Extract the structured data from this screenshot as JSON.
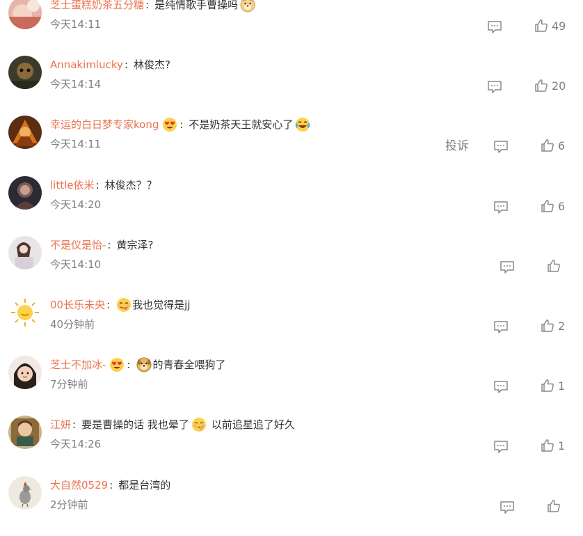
{
  "comments": [
    {
      "user": "芝士蛋糕奶茶五分糖",
      "badge": "",
      "sep": ":",
      "pre_emoji": "",
      "text": "是纯情歌手曹操吗",
      "text_emoji": "doge-icon",
      "text2": "",
      "time": "今天14:11",
      "report": "",
      "likes": "49"
    },
    {
      "user": "Annakimlucky",
      "badge": "",
      "sep": ":",
      "pre_emoji": "",
      "text": "林俊杰?",
      "text_emoji": "",
      "text2": "",
      "time": "今天14:14",
      "report": "",
      "likes": "20"
    },
    {
      "user": "幸运的白日梦专家kong",
      "badge": "heart-eyes-badge-icon",
      "sep": ":",
      "pre_emoji": "",
      "text": "不是奶茶天王就安心了",
      "text_emoji": "crying-laugh-icon",
      "text2": "",
      "time": "今天14:11",
      "report": "投诉",
      "likes": "6"
    },
    {
      "user": "little依米",
      "badge": "",
      "sep": ":",
      "pre_emoji": "",
      "text": "林俊杰？？",
      "text_emoji": "",
      "text2": "",
      "time": "今天14:20",
      "report": "",
      "likes": "6"
    },
    {
      "user": "不是仪是怡-",
      "badge": "",
      "sep": ":",
      "pre_emoji": "",
      "text": "黄宗泽?",
      "text_emoji": "",
      "text2": "",
      "time": "今天14:10",
      "report": "",
      "likes": ""
    },
    {
      "user": "00长乐未央",
      "badge": "",
      "sep": ":",
      "pre_emoji": "yummy-face-icon",
      "text": "我也觉得是jj",
      "text_emoji": "",
      "text2": "",
      "time": "40分钟前",
      "report": "",
      "likes": "2"
    },
    {
      "user": "芝士不加冰-",
      "badge": "heart-eyes-badge-icon",
      "sep": ":",
      "pre_emoji": "dog-face-icon",
      "text": "的青春全喂狗了",
      "text_emoji": "",
      "text2": "",
      "time": "7分钟前",
      "report": "",
      "likes": "1"
    },
    {
      "user": "江妍",
      "badge": "",
      "sep": ":",
      "pre_emoji": "",
      "text": "要是曹操的话 我也晕了",
      "text_emoji": "shy-face-icon",
      "text2": "以前追星追了好久",
      "time": "今天14:26",
      "report": "",
      "likes": "1"
    },
    {
      "user": "大自然0529",
      "badge": "",
      "sep": ":",
      "pre_emoji": "",
      "text": "都是台湾的",
      "text_emoji": "",
      "text2": "",
      "time": "2分钟前",
      "report": "",
      "likes": ""
    }
  ],
  "colors": {
    "username": "#eb7350",
    "text": "#333333",
    "meta": "#808080"
  }
}
